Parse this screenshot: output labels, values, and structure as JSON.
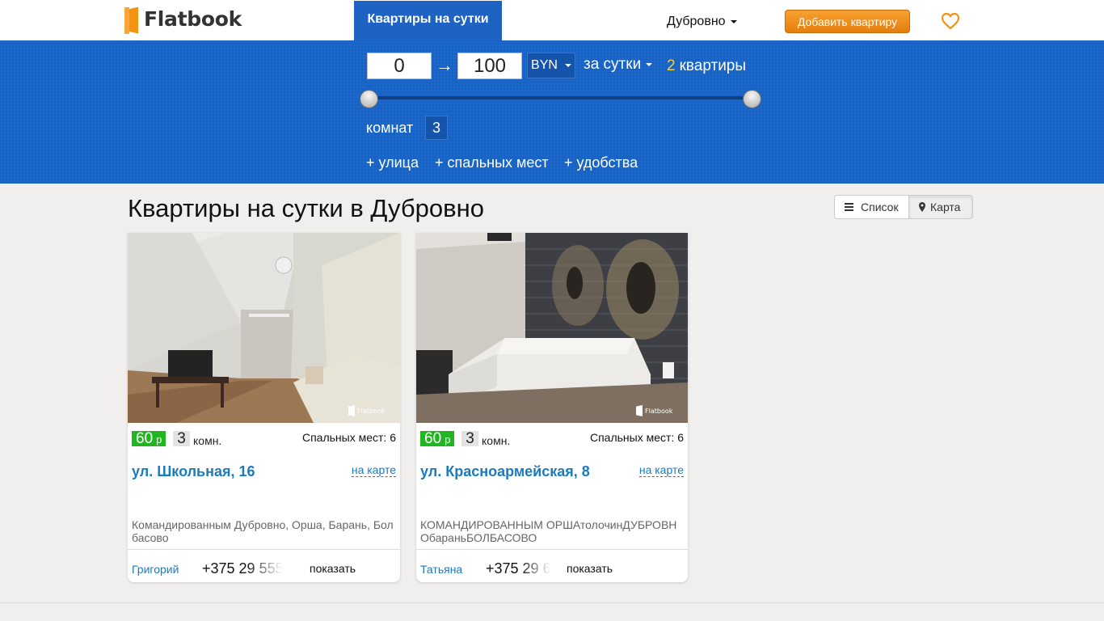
{
  "header": {
    "logo_text": "Flatbook",
    "nav_active": "Квартиры на сутки",
    "city": "Дубровно",
    "add_button": "Добавить квартиру",
    "favorites_icon": "heart-icon",
    "accent_color": "#1763c6",
    "cta_color": "#f39414"
  },
  "filter": {
    "price_min": "0",
    "arrow": "→",
    "price_max": "100",
    "currency": "BYN",
    "period": "за сутки",
    "count": "2",
    "count_label": "квартиры",
    "slider_min_fraction": 0,
    "slider_max_fraction": 1,
    "rooms_label": "комнат",
    "rooms_value": "3",
    "more_street": "+ улица",
    "more_beds": "+ спальных мест",
    "more_amenities": "+ удобства"
  },
  "main": {
    "title": "Квартиры на сутки в Дубровно",
    "view_list": "Список",
    "view_map": "Карта"
  },
  "listings": [
    {
      "price": "60",
      "price_currency": "р",
      "rooms": "3",
      "rooms_label": "комн.",
      "sleeping": "Спальных мест: 6",
      "address": "ул. Школьная, 16",
      "on_map": "на карте",
      "description": "Командированным Дубровно, Орша, Барань, Болбасово",
      "owner": "Григорий",
      "phone": "+375 29 555",
      "show": "показать"
    },
    {
      "price": "60",
      "price_currency": "р",
      "rooms": "3",
      "rooms_label": "комн.",
      "sleeping": "Спальных мест: 6",
      "address": "ул. Красноармейская, 8",
      "on_map": "на карте",
      "description": "КОМАНДИРОВАННЫМ ОРШАтолочинДУБРОВНОбараньБОЛБАСОВО",
      "owner": "Татьяна",
      "phone": "+375 29 6",
      "show": "показать"
    }
  ]
}
